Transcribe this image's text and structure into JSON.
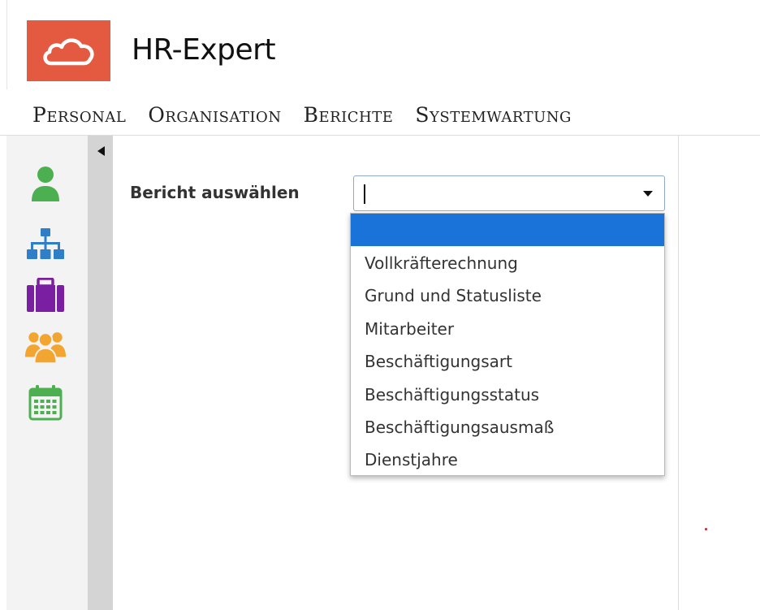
{
  "app": {
    "title": "HR-Expert",
    "logo_icon": "cloud-icon",
    "brand_color": "#e35a41"
  },
  "nav": {
    "items": [
      {
        "label": "Personal"
      },
      {
        "label": "Organisation"
      },
      {
        "label": "Berichte"
      },
      {
        "label": "Systemwartung"
      }
    ]
  },
  "sidebar": {
    "icons": [
      {
        "name": "person-icon",
        "color": "#4caf50"
      },
      {
        "name": "org-chart-icon",
        "color": "#2f7fc8"
      },
      {
        "name": "briefcase-icon",
        "color": "#7b1fa2"
      },
      {
        "name": "group-icon",
        "color": "#f2a531"
      },
      {
        "name": "calendar-icon",
        "color": "#4caf50"
      }
    ]
  },
  "report": {
    "label": "Bericht auswählen",
    "selected_value": "",
    "options": [
      "",
      "Vollkräfterechnung",
      "Grund und Statusliste",
      "Mitarbeiter",
      "Beschäftigungsart",
      "Beschäftigungsstatus",
      "Beschäftigungsausmaß",
      "Dienstjahre"
    ],
    "highlight_color": "#1a73d9"
  }
}
